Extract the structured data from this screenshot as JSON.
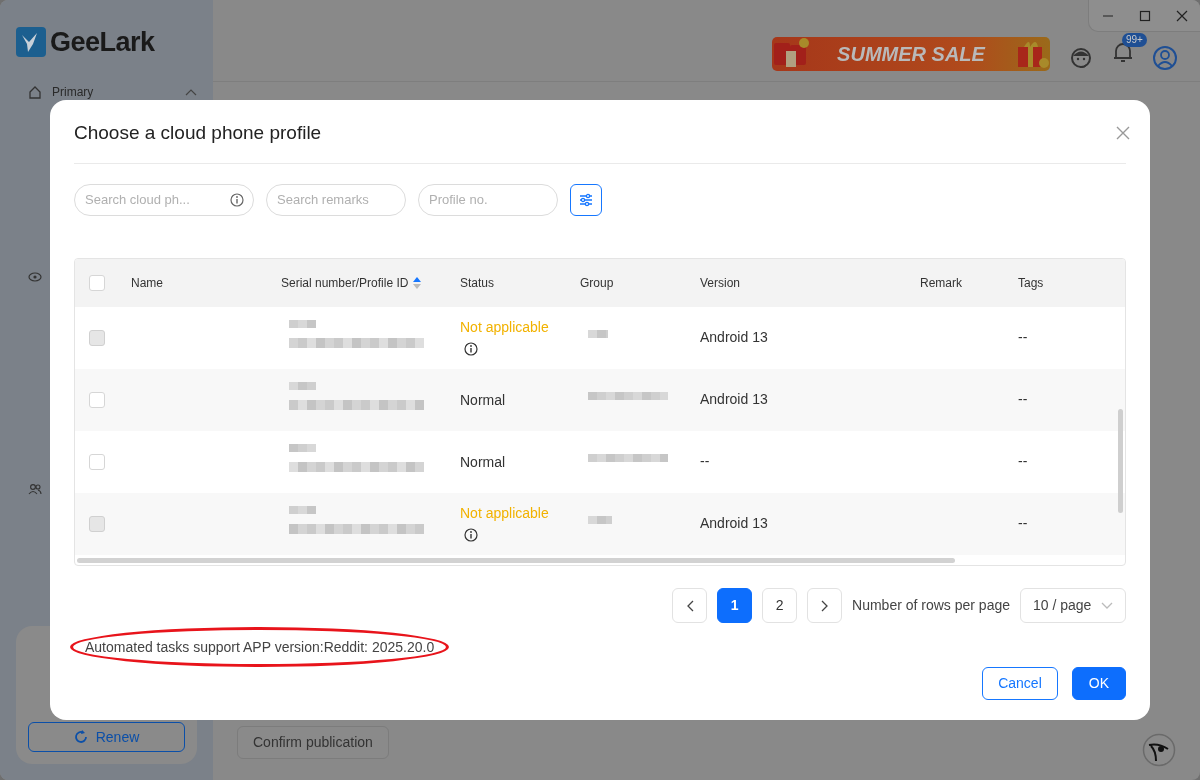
{
  "app": {
    "logo": "GeeLark",
    "nav": [
      {
        "label": "Primary",
        "expanded": true
      }
    ],
    "promo": "SUMMER SALE",
    "notifications": "99+",
    "renew": "Renew",
    "confirm": "Confirm publication"
  },
  "dialog": {
    "title": "Choose a cloud phone profile",
    "filters": [
      {
        "placeholder": "Search cloud ph...",
        "info": true
      },
      {
        "placeholder": "Search remarks",
        "info": false
      },
      {
        "placeholder": "Profile no.",
        "info": false
      }
    ],
    "table": {
      "select_all": {
        "checked": false
      },
      "columns": [
        {
          "label": "Name",
          "sorted_ascending": false
        },
        {
          "label": "Serial number/Profile ID",
          "sorted_ascending": true
        },
        {
          "label": "Status",
          "sorted_ascending": false
        },
        {
          "label": "Group",
          "sorted_ascending": false
        },
        {
          "label": "Version",
          "sorted_ascending": false
        },
        {
          "label": "Remark",
          "sorted_ascending": false
        },
        {
          "label": "Tags",
          "sorted_ascending": false
        }
      ],
      "rows": [
        {
          "checked": false,
          "disabled": true,
          "status": {
            "text": "Not applicable",
            "kind": "warning"
          },
          "version": "Android 13",
          "tags": "--"
        },
        {
          "checked": false,
          "disabled": false,
          "status": {
            "text": "Normal",
            "kind": "normal"
          },
          "version": "Android 13",
          "tags": "--"
        },
        {
          "checked": false,
          "disabled": false,
          "status": {
            "text": "Normal",
            "kind": "normal"
          },
          "version": "--",
          "tags": "--"
        },
        {
          "checked": false,
          "disabled": true,
          "status": {
            "text": "Not applicable",
            "kind": "warning"
          },
          "version": "Android 13",
          "tags": "--"
        }
      ]
    },
    "pagination": {
      "pages": [
        {
          "label": "1",
          "selected": true
        },
        {
          "label": "2",
          "selected": false
        }
      ],
      "rows_label": "Number of rows per page",
      "page_size": "10 / page"
    },
    "note": "Automated tasks support APP version:Reddit: 2025.20.0",
    "buttons": {
      "cancel": "Cancel",
      "ok": "OK"
    }
  }
}
